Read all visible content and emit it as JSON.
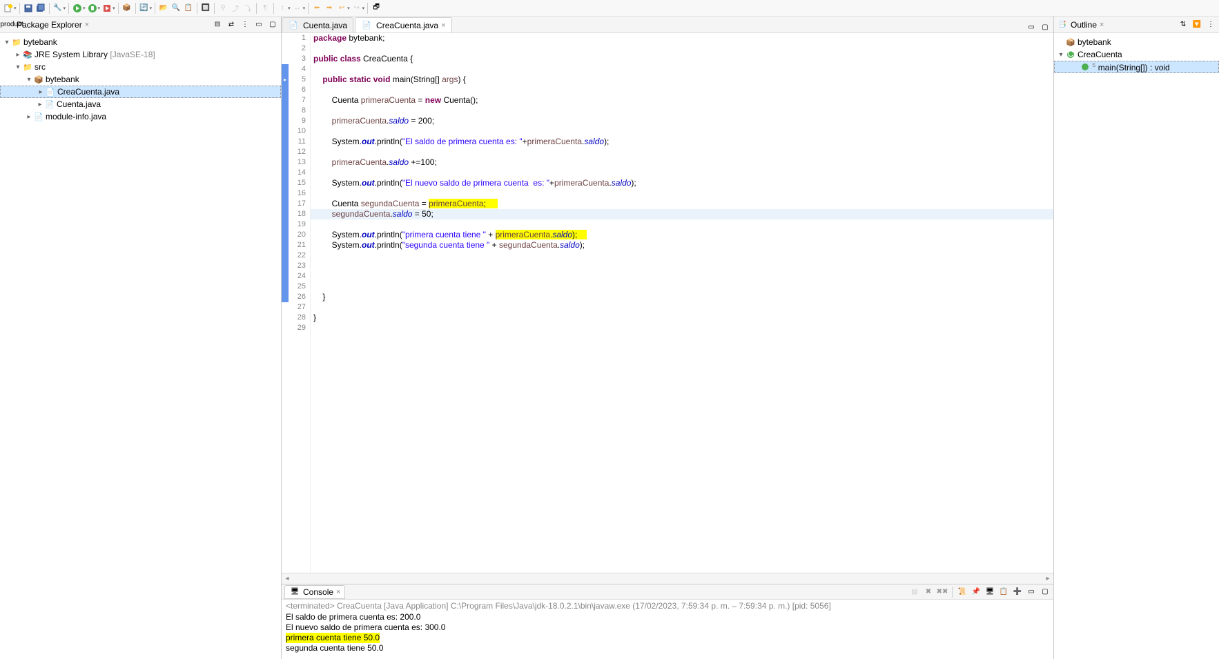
{
  "toolbar": {
    "icons": [
      "new",
      "save",
      "save-all",
      "build",
      "run",
      "debug",
      "run-ext",
      "breakpoint",
      "refresh",
      "open-type",
      "search",
      "task",
      "toggle",
      "nav1",
      "nav2",
      "nav3",
      "nav4",
      "nav5",
      "nav6",
      "back",
      "forward",
      "back2",
      "forward2",
      "perspective"
    ]
  },
  "packageExplorer": {
    "title": "Package Explorer",
    "tree": {
      "project": "bytebank",
      "jre": "JRE System Library",
      "jreVersion": "[JavaSE-18]",
      "src": "src",
      "pkg": "bytebank",
      "files": [
        "CreaCuenta.java",
        "Cuenta.java"
      ],
      "module": "module-info.java"
    }
  },
  "editorTabs": [
    {
      "label": "Cuenta.java",
      "active": false
    },
    {
      "label": "CreaCuenta.java",
      "active": true
    }
  ],
  "code": {
    "lines": [
      {
        "n": 1,
        "marker": "",
        "segs": [
          [
            "kw",
            "package"
          ],
          [
            "plain",
            " bytebank;"
          ]
        ]
      },
      {
        "n": 2,
        "marker": "",
        "segs": []
      },
      {
        "n": 3,
        "marker": "",
        "segs": [
          [
            "kw",
            "public"
          ],
          [
            "plain",
            " "
          ],
          [
            "kw",
            "class"
          ],
          [
            "plain",
            " CreaCuenta {"
          ]
        ]
      },
      {
        "n": 4,
        "marker": "blue",
        "segs": []
      },
      {
        "n": 5,
        "marker": "arrow",
        "segs": [
          [
            "plain",
            "    "
          ],
          [
            "kw",
            "public"
          ],
          [
            "plain",
            " "
          ],
          [
            "kw",
            "static"
          ],
          [
            "plain",
            " "
          ],
          [
            "kw",
            "void"
          ],
          [
            "plain",
            " main(String[] "
          ],
          [
            "var",
            "args"
          ],
          [
            "plain",
            ") {"
          ]
        ]
      },
      {
        "n": 6,
        "marker": "blue",
        "segs": []
      },
      {
        "n": 7,
        "marker": "blue",
        "segs": [
          [
            "plain",
            "        Cuenta "
          ],
          [
            "var",
            "primeraCuenta"
          ],
          [
            "plain",
            " = "
          ],
          [
            "kw",
            "new"
          ],
          [
            "plain",
            " Cuenta();"
          ]
        ]
      },
      {
        "n": 8,
        "marker": "blue",
        "segs": []
      },
      {
        "n": 9,
        "marker": "blue",
        "segs": [
          [
            "plain",
            "        "
          ],
          [
            "var",
            "primeraCuenta"
          ],
          [
            "plain",
            "."
          ],
          [
            "field",
            "saldo"
          ],
          [
            "plain",
            " = 200;"
          ]
        ]
      },
      {
        "n": 10,
        "marker": "blue",
        "segs": []
      },
      {
        "n": 11,
        "marker": "blue",
        "segs": [
          [
            "plain",
            "        System."
          ],
          [
            "static-field",
            "out"
          ],
          [
            "plain",
            ".println("
          ],
          [
            "str",
            "\"El saldo de primera cuenta es: \""
          ],
          [
            "plain",
            "+"
          ],
          [
            "var",
            "primeraCuenta"
          ],
          [
            "plain",
            "."
          ],
          [
            "field",
            "saldo"
          ],
          [
            "plain",
            ");"
          ]
        ]
      },
      {
        "n": 12,
        "marker": "blue",
        "segs": []
      },
      {
        "n": 13,
        "marker": "blue",
        "segs": [
          [
            "plain",
            "        "
          ],
          [
            "var",
            "primeraCuenta"
          ],
          [
            "plain",
            "."
          ],
          [
            "field",
            "saldo"
          ],
          [
            "plain",
            " +=100;"
          ]
        ]
      },
      {
        "n": 14,
        "marker": "blue",
        "segs": []
      },
      {
        "n": 15,
        "marker": "blue",
        "segs": [
          [
            "plain",
            "        System."
          ],
          [
            "static-field",
            "out"
          ],
          [
            "plain",
            ".println("
          ],
          [
            "str",
            "\"El nuevo saldo de primera cuenta  es: \""
          ],
          [
            "plain",
            "+"
          ],
          [
            "var",
            "primeraCuenta"
          ],
          [
            "plain",
            "."
          ],
          [
            "field",
            "saldo"
          ],
          [
            "plain",
            ");"
          ]
        ]
      },
      {
        "n": 16,
        "marker": "blue",
        "segs": []
      },
      {
        "n": 17,
        "marker": "blue",
        "segs": [
          [
            "plain",
            "        Cuenta "
          ],
          [
            "var",
            "segundaCuenta"
          ],
          [
            "plain",
            " = "
          ],
          [
            "hl-var",
            "primeraCuenta"
          ],
          [
            "hl-plain",
            ";     "
          ]
        ]
      },
      {
        "n": 18,
        "marker": "blue",
        "current": true,
        "segs": [
          [
            "plain",
            "        "
          ],
          [
            "var",
            "segundaCuenta"
          ],
          [
            "plain",
            "."
          ],
          [
            "field",
            "saldo"
          ],
          [
            "plain",
            " = 50;"
          ]
        ]
      },
      {
        "n": 19,
        "marker": "blue",
        "segs": []
      },
      {
        "n": 20,
        "marker": "blue",
        "segs": [
          [
            "plain",
            "        System."
          ],
          [
            "static-field",
            "out"
          ],
          [
            "plain",
            ".println("
          ],
          [
            "str",
            "\"primera cuenta tiene \""
          ],
          [
            "plain",
            " + "
          ],
          [
            "hl-var",
            "primeraCuenta"
          ],
          [
            "hl-plain",
            "."
          ],
          [
            "hl-field",
            "saldo"
          ],
          [
            "hl-plain",
            ");    "
          ]
        ]
      },
      {
        "n": 21,
        "marker": "blue",
        "segs": [
          [
            "plain",
            "        System."
          ],
          [
            "static-field",
            "out"
          ],
          [
            "plain",
            ".println("
          ],
          [
            "str",
            "\"segunda cuenta tiene \""
          ],
          [
            "plain",
            " + "
          ],
          [
            "var",
            "segundaCuenta"
          ],
          [
            "plain",
            "."
          ],
          [
            "field",
            "saldo"
          ],
          [
            "plain",
            ");"
          ]
        ]
      },
      {
        "n": 22,
        "marker": "blue",
        "segs": []
      },
      {
        "n": 23,
        "marker": "blue",
        "segs": []
      },
      {
        "n": 24,
        "marker": "blue",
        "segs": []
      },
      {
        "n": 25,
        "marker": "blue",
        "segs": []
      },
      {
        "n": 26,
        "marker": "blue",
        "segs": [
          [
            "plain",
            "    }"
          ]
        ]
      },
      {
        "n": 27,
        "marker": "",
        "segs": []
      },
      {
        "n": 28,
        "marker": "",
        "segs": [
          [
            "plain",
            "}"
          ]
        ]
      },
      {
        "n": 29,
        "marker": "",
        "segs": []
      }
    ]
  },
  "console": {
    "title": "Console",
    "status": "<terminated> CreaCuenta [Java Application] C:\\Program Files\\Java\\jdk-18.0.2.1\\bin\\javaw.exe (17/02/2023, 7:59:34 p. m. – 7:59:34 p. m.) [pid: 5056]",
    "output": [
      {
        "text": "El saldo de primera cuenta es: 200.0",
        "hl": false
      },
      {
        "text": "El nuevo saldo de primera cuenta  es: 300.0",
        "hl": false
      },
      {
        "text": "primera cuenta tiene 50.0",
        "hl": true
      },
      {
        "text": "segunda cuenta tiene 50.0",
        "hl": false
      }
    ]
  },
  "outline": {
    "title": "Outline",
    "items": {
      "pkg": "bytebank",
      "class": "CreaCuenta",
      "method": "main(String[]) : void"
    }
  }
}
